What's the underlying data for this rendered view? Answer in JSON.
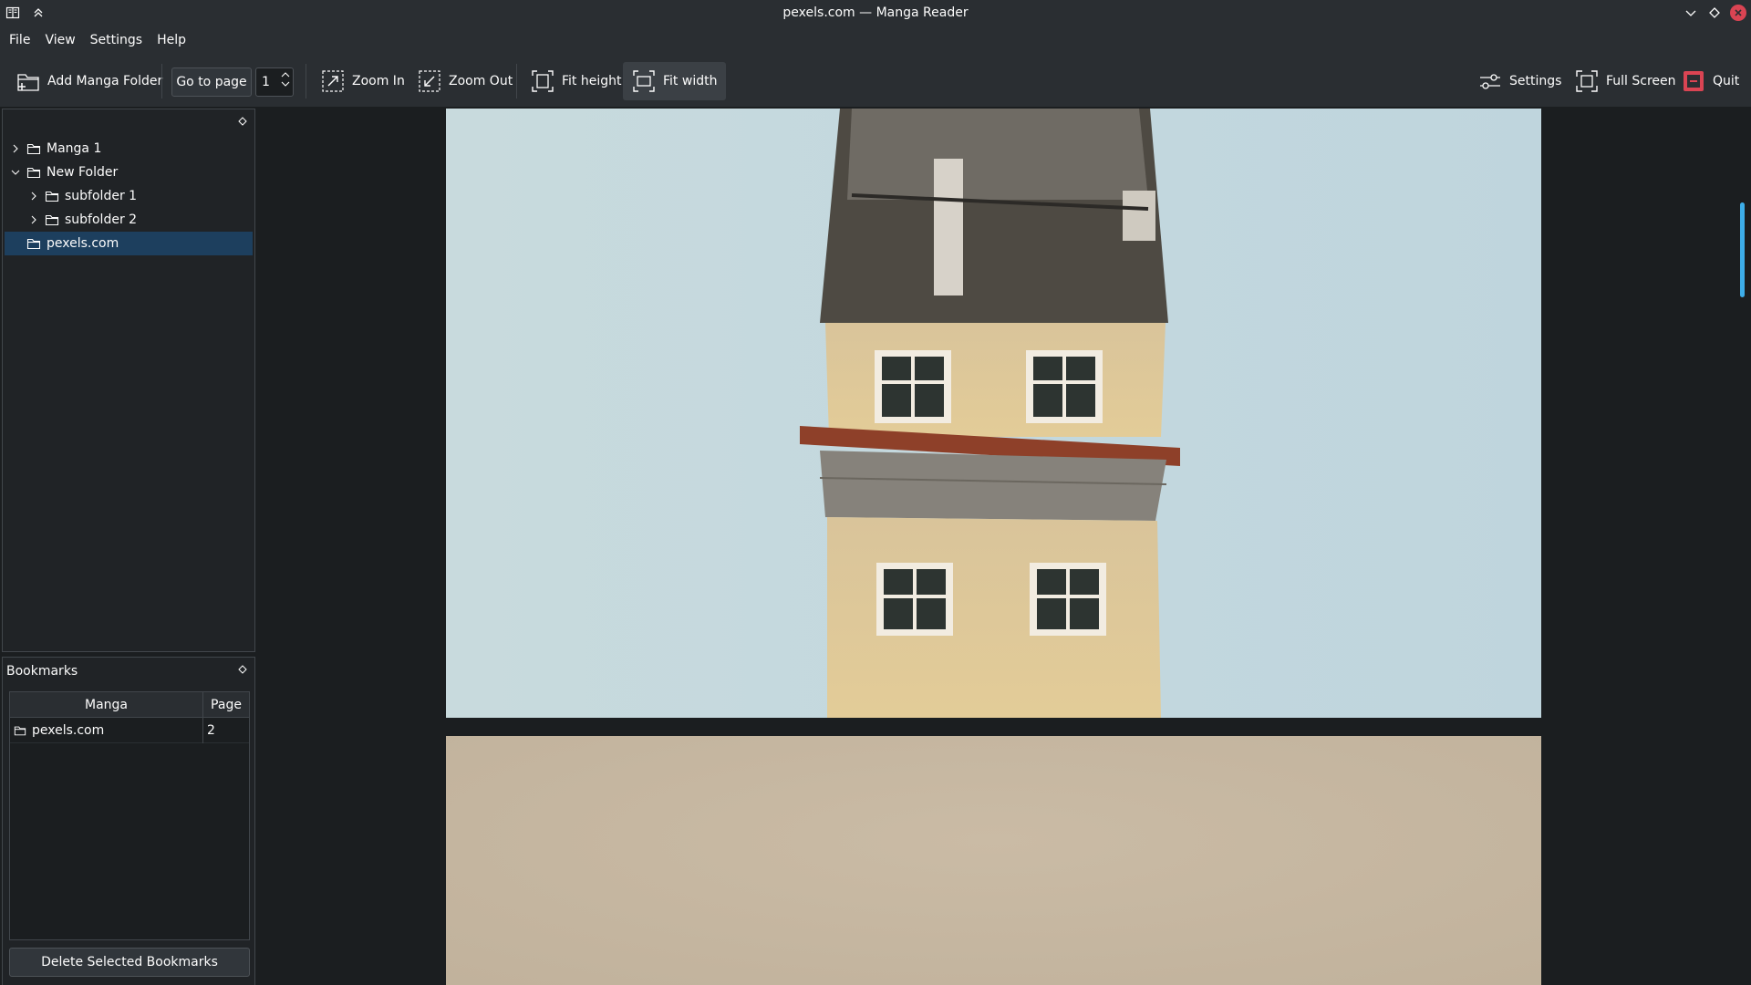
{
  "window": {
    "title": "pexels.com — Manga Reader"
  },
  "menu": {
    "items": [
      "File",
      "View",
      "Settings",
      "Help"
    ]
  },
  "toolbar": {
    "add_manga_folder": "Add Manga Folder",
    "go_to_page": "Go to page",
    "page_value": "1",
    "zoom_in": "Zoom In",
    "zoom_out": "Zoom Out",
    "fit_height": "Fit height",
    "fit_width": "Fit width",
    "settings": "Settings",
    "full_screen": "Full Screen",
    "quit": "Quit"
  },
  "tree": {
    "items": [
      {
        "label": "Manga 1",
        "depth": 0,
        "expanded": false,
        "selected": false
      },
      {
        "label": "New Folder",
        "depth": 0,
        "expanded": true,
        "selected": false
      },
      {
        "label": "subfolder 1",
        "depth": 1,
        "expanded": false,
        "selected": false
      },
      {
        "label": "subfolder 2",
        "depth": 1,
        "expanded": false,
        "selected": false
      },
      {
        "label": "pexels.com",
        "depth": 0,
        "expanded": null,
        "selected": true
      }
    ]
  },
  "bookmarks": {
    "title": "Bookmarks",
    "columns": [
      "Manga",
      "Page"
    ],
    "rows": [
      {
        "manga": "pexels.com",
        "page": "2"
      }
    ],
    "delete_button": "Delete Selected Bookmarks"
  },
  "colors": {
    "accent": "#3daee9",
    "selection": "#1d3f5e",
    "close": "#da4453",
    "quit_icon": "#da4453"
  },
  "icons": {
    "app": "manga-book-icon",
    "keep_above": "chevron-up-icon",
    "minimize": "chevron-down-icon",
    "maximize": "diamond-icon",
    "close": "close-icon"
  }
}
